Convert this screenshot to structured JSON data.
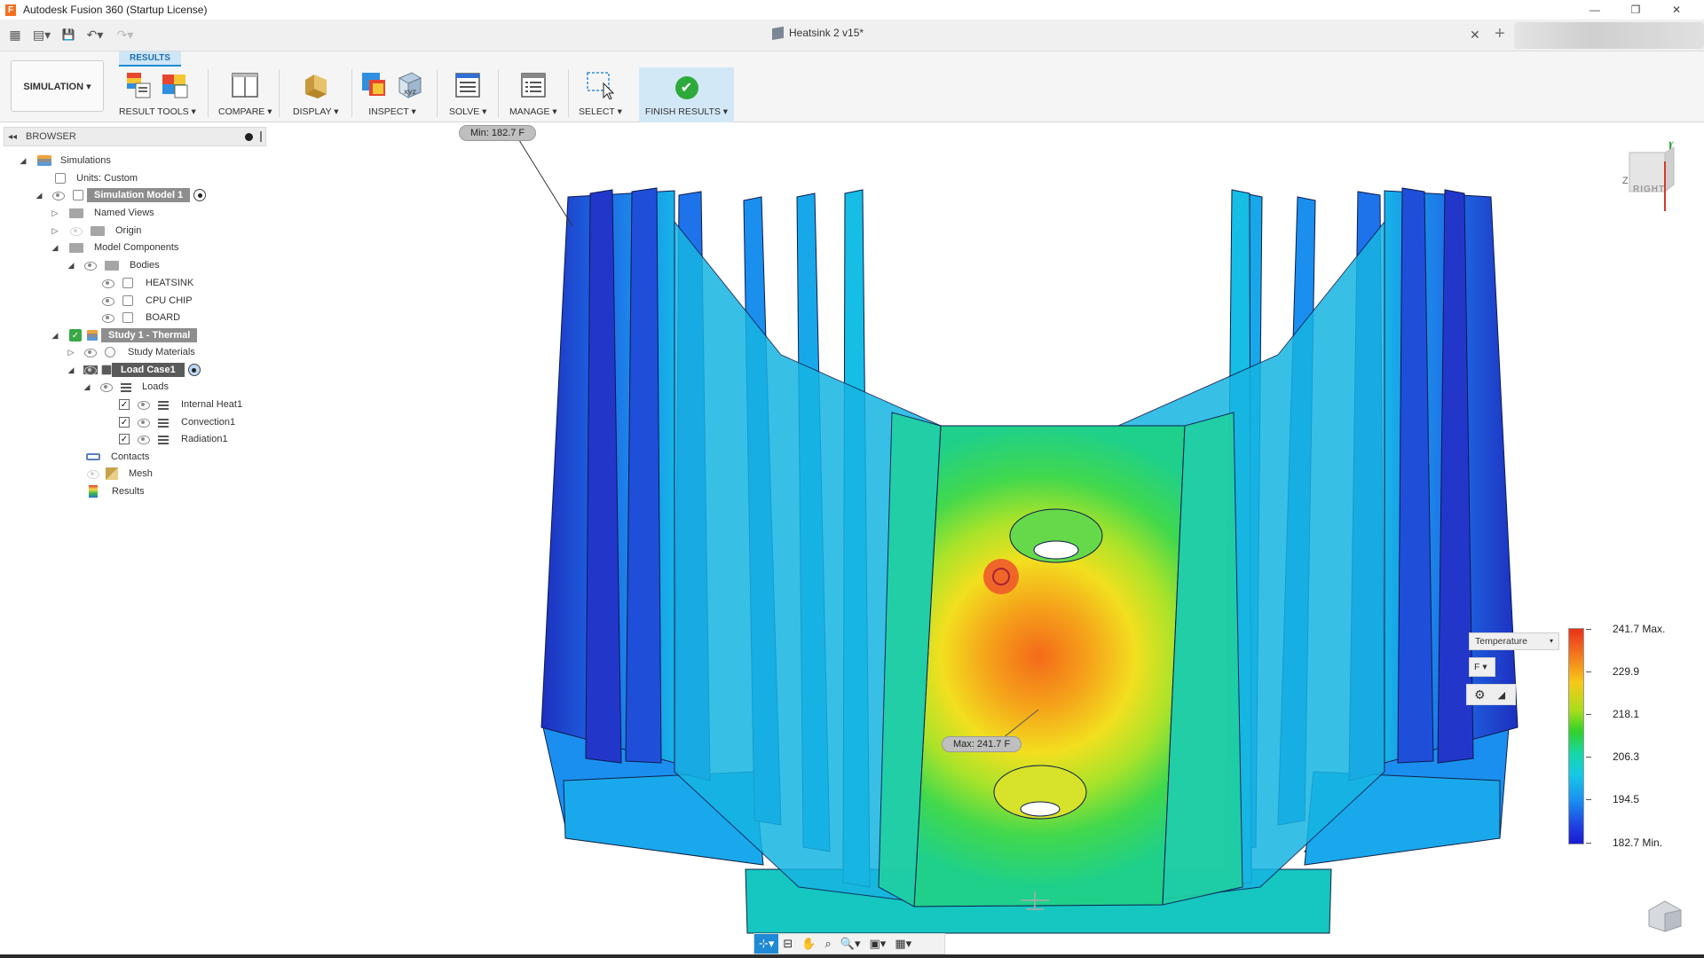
{
  "window": {
    "title": "Autodesk Fusion 360 (Startup License)",
    "logo_letter": "F",
    "minimize": "—",
    "maximize": "❐",
    "close": "✕"
  },
  "document": {
    "tab_title": "Heatsink 2 v15*",
    "close_glyph": "✕",
    "add_glyph": "+"
  },
  "quick_access": {
    "grid_glyph": "▦",
    "file_glyph": "▤▾",
    "save_glyph": "💾",
    "undo_glyph": "↶▾",
    "redo_glyph": "↷▾"
  },
  "toolbar": {
    "workspace": "SIMULATION ▾",
    "active_tab": "RESULTS",
    "groups": [
      {
        "label": "RESULT TOOLS ▾"
      },
      {
        "label": "COMPARE ▾"
      },
      {
        "label": "DISPLAY ▾"
      },
      {
        "label": "INSPECT ▾"
      },
      {
        "label": "SOLVE ▾"
      },
      {
        "label": "MANAGE ▾"
      },
      {
        "label": "SELECT ▾"
      },
      {
        "label": "FINISH RESULTS ▾"
      }
    ],
    "finish_check": "✔",
    "inspect_xyz": "xyz"
  },
  "browser": {
    "header": "BROWSER",
    "collapse_glyph": "◂◂",
    "items": [
      {
        "label": "Simulations"
      },
      {
        "label": "Units: Custom"
      },
      {
        "label": "Simulation Model 1"
      },
      {
        "label": "Named Views"
      },
      {
        "label": "Origin"
      },
      {
        "label": "Model Components"
      },
      {
        "label": "Bodies"
      },
      {
        "label": "HEATSINK"
      },
      {
        "label": "CPU CHIP"
      },
      {
        "label": "BOARD"
      },
      {
        "label": "Study 1 - Thermal"
      },
      {
        "label": "Study Materials"
      },
      {
        "label": "Load Case1"
      },
      {
        "label": "Loads"
      },
      {
        "label": "Internal Heat1"
      },
      {
        "label": "Convection1"
      },
      {
        "label": "Radiation1"
      },
      {
        "label": "Contacts"
      },
      {
        "label": "Mesh"
      },
      {
        "label": "Results"
      }
    ],
    "check_glyph": "✓",
    "tri_open": "◢",
    "tri_closed": "▷"
  },
  "viewport": {
    "min_probe": "Min: 182.7 F",
    "max_probe": "Max: 241.7 F"
  },
  "legend": {
    "result_type": "Temperature",
    "result_caret": "▾",
    "unit": "F ▾",
    "settings_glyph": "⚙",
    "expand_glyph": "◢",
    "max_value": 241.7,
    "min_value": 182.7,
    "ticks": [
      "241.7 Max.",
      "229.9",
      "218.1",
      "206.3",
      "194.5",
      "182.7 Min."
    ]
  },
  "viewcube": {
    "face": "RIGHT",
    "axis_z": "Z",
    "axis_y": "Y"
  },
  "navbar": {
    "items": [
      "⊹▾",
      "⊟",
      "✋",
      "⌕",
      "🔍▾",
      "▣▾",
      "▦▾"
    ]
  },
  "colors": {
    "accent": "#1f8ad6",
    "finish_bg": "#d3e8f7",
    "check_green": "#2eaa3c",
    "hot": "#e8321b",
    "cold": "#1a1bd0"
  }
}
